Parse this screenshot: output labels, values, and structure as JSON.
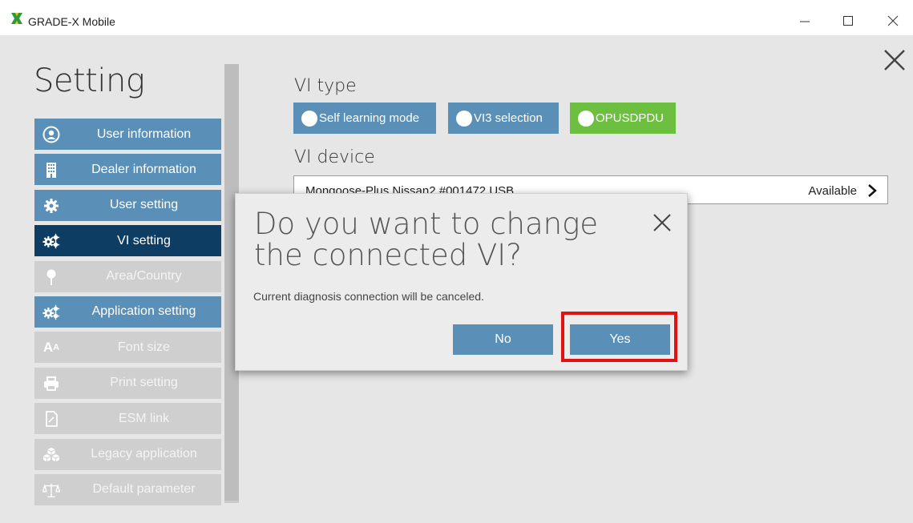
{
  "window": {
    "title": "GRADE-X Mobile",
    "controls": [
      "minimize-icon",
      "maximize-icon",
      "close-icon"
    ]
  },
  "page": {
    "heading": "Setting",
    "close_icon": "close-icon"
  },
  "menu": {
    "items": [
      {
        "label": "User information",
        "icon": "user-icon",
        "state": "normal"
      },
      {
        "label": "Dealer information",
        "icon": "building-icon",
        "state": "normal"
      },
      {
        "label": "User setting",
        "icon": "gear-icon",
        "state": "normal"
      },
      {
        "label": "VI setting",
        "icon": "gears-icon",
        "state": "active"
      },
      {
        "label": "Area/Country",
        "icon": "pin-icon",
        "state": "disabled"
      },
      {
        "label": "Application setting",
        "icon": "gears-icon",
        "state": "normal"
      },
      {
        "label": "Font size",
        "icon": "font-size-icon",
        "state": "disabled"
      },
      {
        "label": "Print setting",
        "icon": "printer-icon",
        "state": "disabled"
      },
      {
        "label": "ESM link",
        "icon": "document-icon",
        "state": "disabled"
      },
      {
        "label": "Legacy application",
        "icon": "boxes-icon",
        "state": "disabled"
      },
      {
        "label": "Default parameter",
        "icon": "scale-icon",
        "state": "disabled"
      }
    ]
  },
  "vi_type": {
    "label": "VI type",
    "options": [
      {
        "label": "Self learning mode",
        "selected": false
      },
      {
        "label": "VI3 selection",
        "selected": false
      },
      {
        "label": "OPUSDPDU",
        "selected": true
      }
    ]
  },
  "vi_device": {
    "label": "VI device",
    "name": "Mongoose-Plus Nissan2 #001472 USB",
    "status": "Available"
  },
  "dialog": {
    "title": "Do you want to change the connected VI?",
    "message": "Current diagnosis connection will be canceled.",
    "no_label": "No",
    "yes_label": "Yes"
  },
  "colors": {
    "menu_blue": "#5a8fb7",
    "menu_active": "#0e3d63",
    "menu_disabled": "#cfcfcf",
    "selected_green": "#6cbf3f",
    "highlight_red": "#e31212"
  }
}
